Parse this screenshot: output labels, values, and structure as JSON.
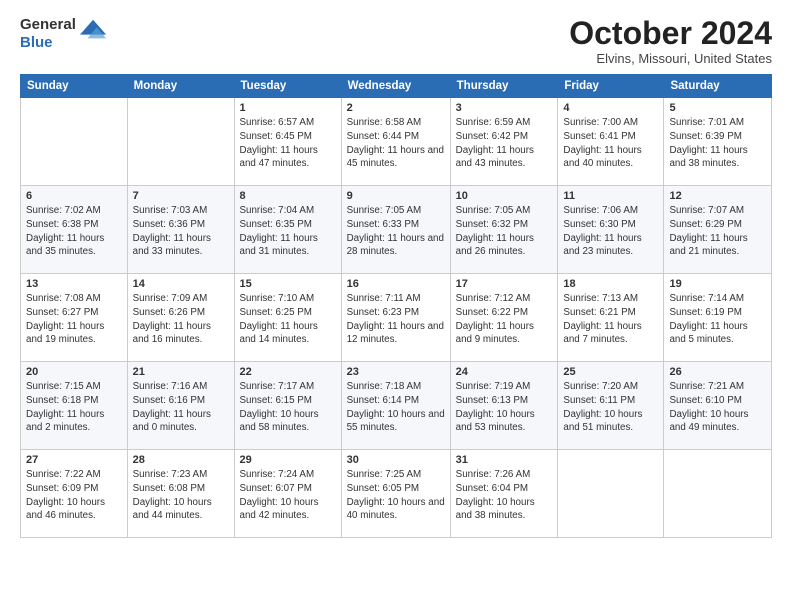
{
  "header": {
    "logo": {
      "general": "General",
      "blue": "Blue"
    },
    "title": "October 2024",
    "location": "Elvins, Missouri, United States"
  },
  "weekdays": [
    "Sunday",
    "Monday",
    "Tuesday",
    "Wednesday",
    "Thursday",
    "Friday",
    "Saturday"
  ],
  "weeks": [
    [
      {
        "day": null
      },
      {
        "day": null
      },
      {
        "day": 1,
        "sunrise": "6:57 AM",
        "sunset": "6:45 PM",
        "daylight": "11 hours and 47 minutes."
      },
      {
        "day": 2,
        "sunrise": "6:58 AM",
        "sunset": "6:44 PM",
        "daylight": "11 hours and 45 minutes."
      },
      {
        "day": 3,
        "sunrise": "6:59 AM",
        "sunset": "6:42 PM",
        "daylight": "11 hours and 43 minutes."
      },
      {
        "day": 4,
        "sunrise": "7:00 AM",
        "sunset": "6:41 PM",
        "daylight": "11 hours and 40 minutes."
      },
      {
        "day": 5,
        "sunrise": "7:01 AM",
        "sunset": "6:39 PM",
        "daylight": "11 hours and 38 minutes."
      }
    ],
    [
      {
        "day": 6,
        "sunrise": "7:02 AM",
        "sunset": "6:38 PM",
        "daylight": "11 hours and 35 minutes."
      },
      {
        "day": 7,
        "sunrise": "7:03 AM",
        "sunset": "6:36 PM",
        "daylight": "11 hours and 33 minutes."
      },
      {
        "day": 8,
        "sunrise": "7:04 AM",
        "sunset": "6:35 PM",
        "daylight": "11 hours and 31 minutes."
      },
      {
        "day": 9,
        "sunrise": "7:05 AM",
        "sunset": "6:33 PM",
        "daylight": "11 hours and 28 minutes."
      },
      {
        "day": 10,
        "sunrise": "7:05 AM",
        "sunset": "6:32 PM",
        "daylight": "11 hours and 26 minutes."
      },
      {
        "day": 11,
        "sunrise": "7:06 AM",
        "sunset": "6:30 PM",
        "daylight": "11 hours and 23 minutes."
      },
      {
        "day": 12,
        "sunrise": "7:07 AM",
        "sunset": "6:29 PM",
        "daylight": "11 hours and 21 minutes."
      }
    ],
    [
      {
        "day": 13,
        "sunrise": "7:08 AM",
        "sunset": "6:27 PM",
        "daylight": "11 hours and 19 minutes."
      },
      {
        "day": 14,
        "sunrise": "7:09 AM",
        "sunset": "6:26 PM",
        "daylight": "11 hours and 16 minutes."
      },
      {
        "day": 15,
        "sunrise": "7:10 AM",
        "sunset": "6:25 PM",
        "daylight": "11 hours and 14 minutes."
      },
      {
        "day": 16,
        "sunrise": "7:11 AM",
        "sunset": "6:23 PM",
        "daylight": "11 hours and 12 minutes."
      },
      {
        "day": 17,
        "sunrise": "7:12 AM",
        "sunset": "6:22 PM",
        "daylight": "11 hours and 9 minutes."
      },
      {
        "day": 18,
        "sunrise": "7:13 AM",
        "sunset": "6:21 PM",
        "daylight": "11 hours and 7 minutes."
      },
      {
        "day": 19,
        "sunrise": "7:14 AM",
        "sunset": "6:19 PM",
        "daylight": "11 hours and 5 minutes."
      }
    ],
    [
      {
        "day": 20,
        "sunrise": "7:15 AM",
        "sunset": "6:18 PM",
        "daylight": "11 hours and 2 minutes."
      },
      {
        "day": 21,
        "sunrise": "7:16 AM",
        "sunset": "6:16 PM",
        "daylight": "11 hours and 0 minutes."
      },
      {
        "day": 22,
        "sunrise": "7:17 AM",
        "sunset": "6:15 PM",
        "daylight": "10 hours and 58 minutes."
      },
      {
        "day": 23,
        "sunrise": "7:18 AM",
        "sunset": "6:14 PM",
        "daylight": "10 hours and 55 minutes."
      },
      {
        "day": 24,
        "sunrise": "7:19 AM",
        "sunset": "6:13 PM",
        "daylight": "10 hours and 53 minutes."
      },
      {
        "day": 25,
        "sunrise": "7:20 AM",
        "sunset": "6:11 PM",
        "daylight": "10 hours and 51 minutes."
      },
      {
        "day": 26,
        "sunrise": "7:21 AM",
        "sunset": "6:10 PM",
        "daylight": "10 hours and 49 minutes."
      }
    ],
    [
      {
        "day": 27,
        "sunrise": "7:22 AM",
        "sunset": "6:09 PM",
        "daylight": "10 hours and 46 minutes."
      },
      {
        "day": 28,
        "sunrise": "7:23 AM",
        "sunset": "6:08 PM",
        "daylight": "10 hours and 44 minutes."
      },
      {
        "day": 29,
        "sunrise": "7:24 AM",
        "sunset": "6:07 PM",
        "daylight": "10 hours and 42 minutes."
      },
      {
        "day": 30,
        "sunrise": "7:25 AM",
        "sunset": "6:05 PM",
        "daylight": "10 hours and 40 minutes."
      },
      {
        "day": 31,
        "sunrise": "7:26 AM",
        "sunset": "6:04 PM",
        "daylight": "10 hours and 38 minutes."
      },
      {
        "day": null
      },
      {
        "day": null
      }
    ]
  ]
}
